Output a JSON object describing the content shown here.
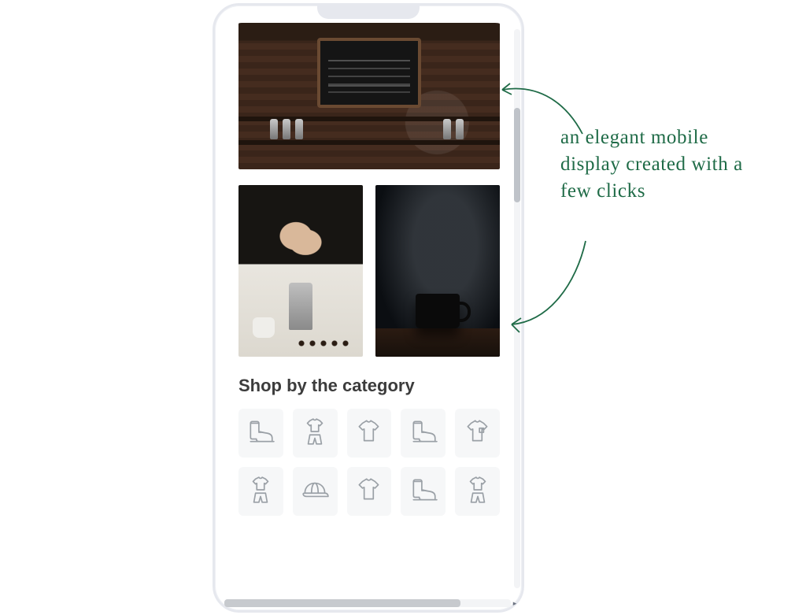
{
  "annotation": {
    "text": "an elegant mobile display created with a few clicks"
  },
  "section": {
    "title": "Shop by the category"
  },
  "categories": {
    "row1": [
      {
        "icon": "boot-icon"
      },
      {
        "icon": "outfit-icon"
      },
      {
        "icon": "tshirt-icon"
      },
      {
        "icon": "boot-icon"
      },
      {
        "icon": "pocket-tee-icon"
      }
    ],
    "row2": [
      {
        "icon": "outfit-icon"
      },
      {
        "icon": "cap-icon"
      },
      {
        "icon": "tshirt-icon"
      },
      {
        "icon": "boot-icon"
      },
      {
        "icon": "outfit-icon"
      }
    ]
  },
  "images": {
    "hero_alt": "coffee shop counter with chalkboard menu",
    "left_alt": "barista hands with drip coffee brewer",
    "right_alt": "black coffee cup with steam on dark background"
  },
  "colors": {
    "accent": "#1f6b47",
    "tile_bg": "#f6f7f8",
    "icon": "#9aa0a6"
  }
}
